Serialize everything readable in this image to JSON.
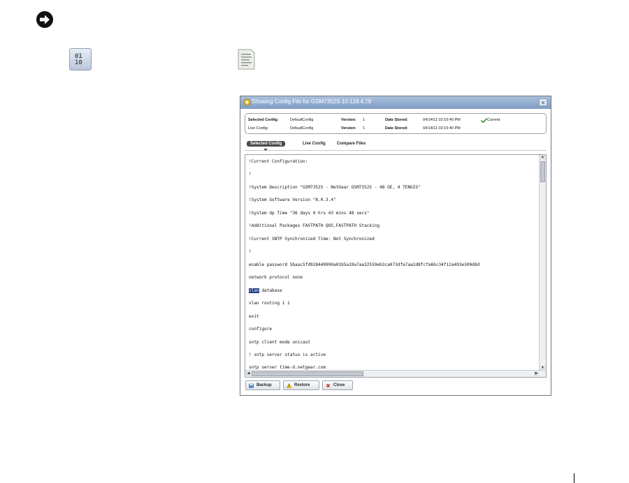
{
  "dialog": {
    "title": "Showing Config File for GSM7352S-10.128.4.79",
    "close_label": "✕",
    "info": {
      "selected_config_label": "Selected Config:",
      "selected_config_value": "DefaultConfig",
      "live_config_label": "Live Config:",
      "live_config_value": "DefaultConfig",
      "version_label": "Version:",
      "selected_version": "1",
      "live_version": "1",
      "date_stored_label": "Date Stored:",
      "selected_date": "04/14/11 02:10:40 PM",
      "live_date": "04/14/11 02:10:40 PM",
      "current_label": "Current"
    },
    "tabs": [
      "Selected Config",
      "Live Config",
      "Compare Files"
    ],
    "active_tab": "Selected Config",
    "config_lines": [
      "!Current Configuration:",
      "!",
      "!System Description \"GSM7352S - NetGear GSM7352S - 48 GE, 4 TENGIG\"",
      "!System Software Version \"8.0.3.4\"",
      "!System Up Time          \"36 days 0 hrs 43 mins 48 secs\"",
      "!Additional Packages     FASTPATH QOS,FASTPATH Stacking",
      "!Current SNTP Synchronized Time: Not Synchronized",
      "!",
      "enable password 5baac5fd928449990a01b5a19a7aa32559eb3ca073dfa7aa2d8fcfa6bc34f12a493e309d8d",
      "network protocol none",
      "database",
      "vlan routing 1 1",
      "exit",
      "configure",
      "sntp client mode unicast",
      "! sntp server status is active",
      "sntp server time-d.netgear.com"
    ],
    "highlight_word": "vlan",
    "buttons": {
      "backup": "Backup",
      "restore": "Restore",
      "close": "Close"
    }
  },
  "icons": {
    "binary_icon_text_top": "01",
    "binary_icon_text_bottom": "10"
  }
}
